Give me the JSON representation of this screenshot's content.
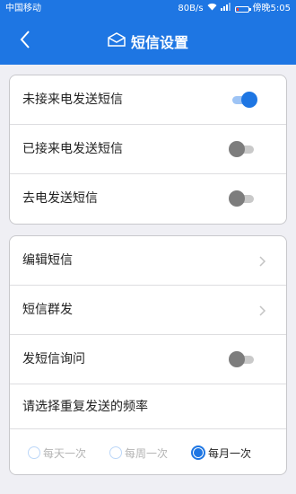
{
  "status_bar": {
    "carrier": "中国移动",
    "net_speed": "80B/s",
    "time": "傍晚5:05",
    "battery_level": 0.2
  },
  "header": {
    "title": "短信设置",
    "back_icon": "chevron-left-icon",
    "title_icon": "envelope-icon"
  },
  "auto_sms": {
    "items": [
      {
        "label": "未接来电发送短信",
        "on": true
      },
      {
        "label": "已接来电发送短信",
        "on": false
      },
      {
        "label": "去电发送短信",
        "on": false
      }
    ]
  },
  "sms_settings": {
    "edit_label": "编辑短信",
    "group_label": "短信群发",
    "inquiry_label": "发短信询问",
    "inquiry_on": false,
    "frequency_label": "请选择重复发送的频率",
    "frequency_options": [
      "每天一次",
      "每周一次",
      "每月一次"
    ],
    "frequency_selected": "每月一次"
  },
  "colors": {
    "primary": "#1e76e3",
    "background": "#efeff4",
    "toggle_off": "#7d7d7d"
  }
}
